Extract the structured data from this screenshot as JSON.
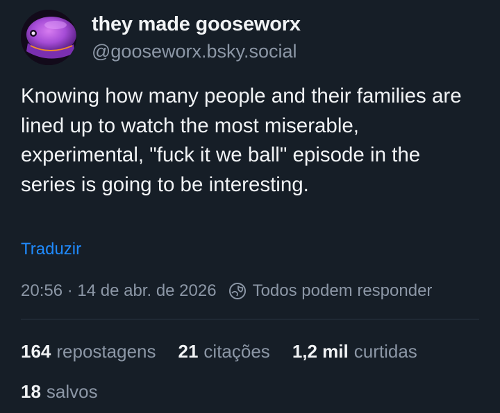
{
  "author": {
    "display_name": "they made gooseworx",
    "handle": "@gooseworx.bsky.social"
  },
  "post": {
    "text": "Knowing how many people and their families are lined up to watch the most miserable, experimental, \"fuck it we ball\" episode in the series is going to be interesting.",
    "translate_label": "Traduzir",
    "timestamp": "20:56 · 14 de abr. de 2026",
    "reply_setting": "Todos podem responder",
    "reply_icon": "globe-icon"
  },
  "stats": {
    "reposts": {
      "count": "164",
      "label": "repostagens"
    },
    "quotes": {
      "count": "21",
      "label": "citações"
    },
    "likes": {
      "count": "1,2 mil",
      "label": "curtidas"
    },
    "saves": {
      "count": "18",
      "label": "salvos"
    }
  },
  "colors": {
    "background": "#161e27",
    "text": "#f1f3f5",
    "muted": "#8c97a6",
    "link": "#208bfe"
  }
}
